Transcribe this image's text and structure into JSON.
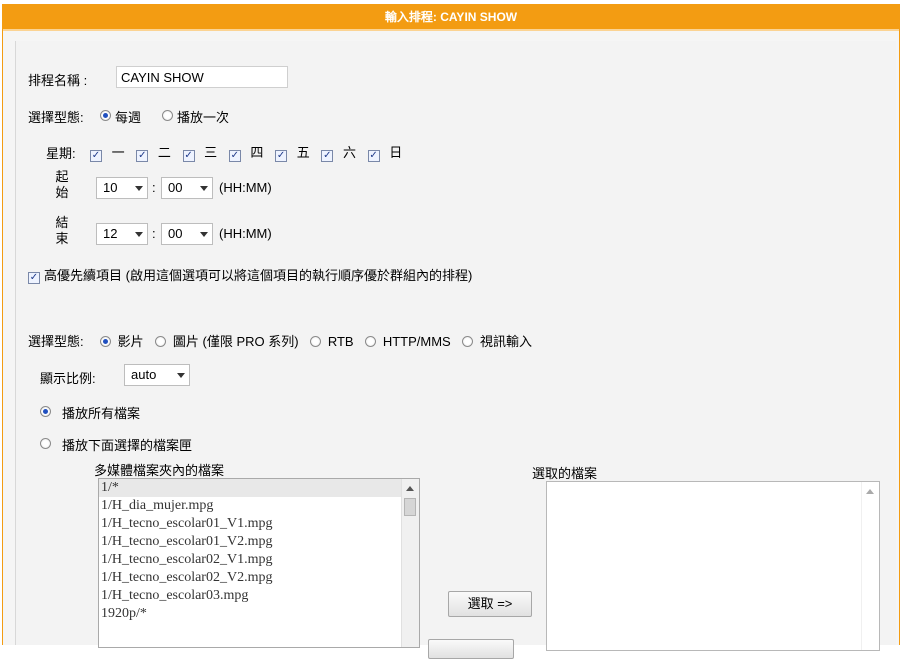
{
  "title": "輸入排程: CAYIN SHOW",
  "schedule_name": {
    "label": "排程名稱 :",
    "value": "CAYIN SHOW"
  },
  "type1": {
    "label": "選擇型態:",
    "options": [
      "每週",
      "播放一次"
    ],
    "selected": "每週"
  },
  "weekdays": {
    "label": "星期:",
    "days": [
      "一",
      "二",
      "三",
      "四",
      "五",
      "六",
      "日"
    ],
    "checked": [
      true,
      true,
      true,
      true,
      true,
      true,
      true
    ]
  },
  "start": {
    "label_top": "起",
    "label_bottom": "始",
    "hour": "10",
    "minute": "00",
    "sep": ":",
    "format": "(HH:MM)"
  },
  "end": {
    "label_top": "結",
    "label_bottom": "束",
    "hour": "12",
    "minute": "00",
    "sep": ":",
    "format": "(HH:MM)"
  },
  "priority": {
    "checked": true,
    "label": "高優先續項目 (啟用這個選項可以將這個項目的執行順序優於群組內的排程)"
  },
  "type2": {
    "label": "選擇型態:",
    "options": [
      "影片",
      "圖片 (僅限 PRO 系列)",
      "RTB",
      "HTTP/MMS",
      "視訊輸入"
    ],
    "selected": "影片"
  },
  "aspect": {
    "label": "顯示比例:",
    "value": "auto"
  },
  "play_mode": {
    "options": [
      "播放所有檔案",
      "播放下面選擇的檔案匣"
    ],
    "selected": "播放所有檔案"
  },
  "file_list": {
    "label": "多媒體檔案夾內的檔案",
    "items": [
      "1/*",
      "1/H_dia_mujer.mpg",
      "1/H_tecno_escolar01_V1.mpg",
      "1/H_tecno_escolar01_V2.mpg",
      "1/H_tecno_escolar02_V1.mpg",
      "1/H_tecno_escolar02_V2.mpg",
      "1/H_tecno_escolar03.mpg",
      "1920p/*"
    ]
  },
  "selected_list": {
    "label": "選取的檔案"
  },
  "select_button": "選取 =>",
  "colors": {
    "header": "#f39c12",
    "accent": "#1f4fbf"
  }
}
